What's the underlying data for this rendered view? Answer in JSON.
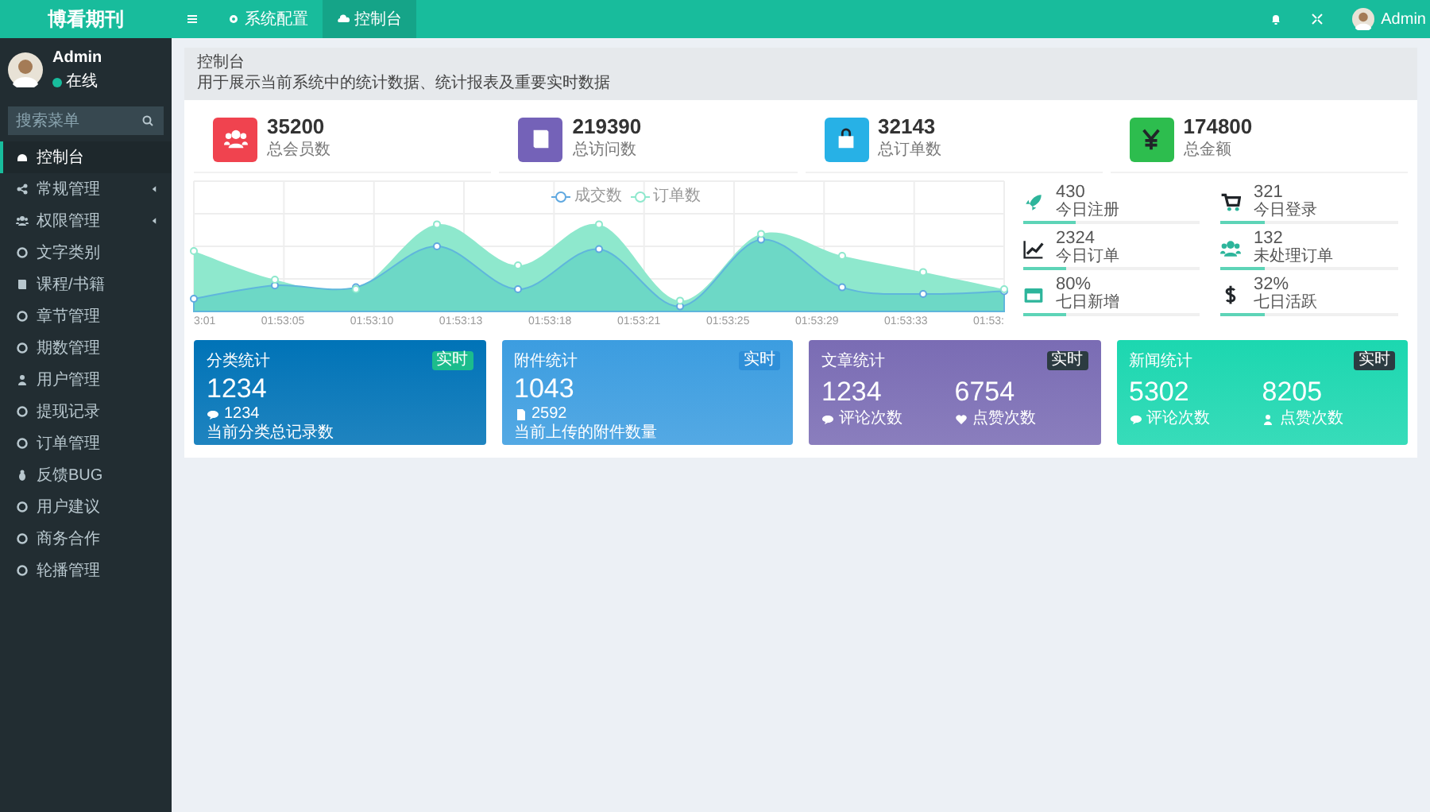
{
  "logo": "博看期刊",
  "topbar": {
    "tabs": [
      {
        "label": "系统配置",
        "selected": false
      },
      {
        "label": "控制台",
        "selected": true
      }
    ],
    "user": "Admin"
  },
  "sidebar": {
    "user": {
      "name": "Admin",
      "status": "在线"
    },
    "search": {
      "placeholder": "搜索菜单"
    },
    "items": [
      {
        "label": "控制台",
        "selected": true,
        "expandable": false
      },
      {
        "label": "常规管理",
        "selected": false,
        "expandable": true
      },
      {
        "label": "权限管理",
        "selected": false,
        "expandable": true
      },
      {
        "label": "文字类别",
        "selected": false,
        "expandable": false
      },
      {
        "label": "课程/书籍",
        "selected": false,
        "expandable": false
      },
      {
        "label": "章节管理",
        "selected": false,
        "expandable": false
      },
      {
        "label": "期数管理",
        "selected": false,
        "expandable": false
      },
      {
        "label": "用户管理",
        "selected": false,
        "expandable": false
      },
      {
        "label": "提现记录",
        "selected": false,
        "expandable": false
      },
      {
        "label": "订单管理",
        "selected": false,
        "expandable": false
      },
      {
        "label": "反馈BUG",
        "selected": false,
        "expandable": false
      },
      {
        "label": "用户建议",
        "selected": false,
        "expandable": false
      },
      {
        "label": "商务合作",
        "selected": false,
        "expandable": false
      },
      {
        "label": "轮播管理",
        "selected": false,
        "expandable": false
      }
    ]
  },
  "header": {
    "title": "控制台",
    "description": "用于展示当前系统中的统计数据、统计报表及重要实时数据"
  },
  "stats": [
    {
      "value": "35200",
      "label": "总会员数",
      "color": "#f0434f"
    },
    {
      "value": "219390",
      "label": "总访问数",
      "color": "#7462b8"
    },
    {
      "value": "32143",
      "label": "总订单数",
      "color": "#27b1e6"
    },
    {
      "value": "174800",
      "label": "总金额",
      "color": "#2dbd4e"
    }
  ],
  "chart": {
    "legend": [
      "成交数",
      "订单数"
    ],
    "xlabels": [
      "3:01",
      "01:53:05",
      "01:53:10",
      "01:53:13",
      "01:53:18",
      "01:53:21",
      "01:53:25",
      "01:53:29",
      "01:53:33",
      "01:53:"
    ]
  },
  "mini_stats": [
    {
      "value": "430",
      "label": "今日注册",
      "level": 0.3
    },
    {
      "value": "321",
      "label": "今日登录",
      "level": 0.25
    },
    {
      "value": "2324",
      "label": "今日订单",
      "level": 0.25
    },
    {
      "value": "132",
      "label": "未处理订单",
      "level": 0.25
    },
    {
      "value": "80%",
      "label": "七日新增",
      "level": 0.25
    },
    {
      "value": "32%",
      "label": "七日活跃",
      "level": 0.25
    }
  ],
  "cards": [
    {
      "kind": "single",
      "title": "分类统计",
      "badge": "实时",
      "color": "#0073b7",
      "value": "1234",
      "sub_value": "1234",
      "note": "当前分类总记录数"
    },
    {
      "kind": "single",
      "title": "附件统计",
      "badge": "实时",
      "color": "#3c9de0",
      "value": "1043",
      "sub_value": "2592",
      "note": "当前上传的附件数量"
    },
    {
      "kind": "double",
      "title": "文章统计",
      "badge": "实时",
      "color": "#7a6cb4",
      "values": [
        {
          "value": "1234",
          "label": "评论次数"
        },
        {
          "value": "6754",
          "label": "点赞次数"
        }
      ]
    },
    {
      "kind": "double",
      "title": "新闻统计",
      "badge": "实时",
      "color": "#1cd7b0",
      "values": [
        {
          "value": "5302",
          "label": "评论次数"
        },
        {
          "value": "8205",
          "label": "点赞次数"
        }
      ]
    }
  ]
}
